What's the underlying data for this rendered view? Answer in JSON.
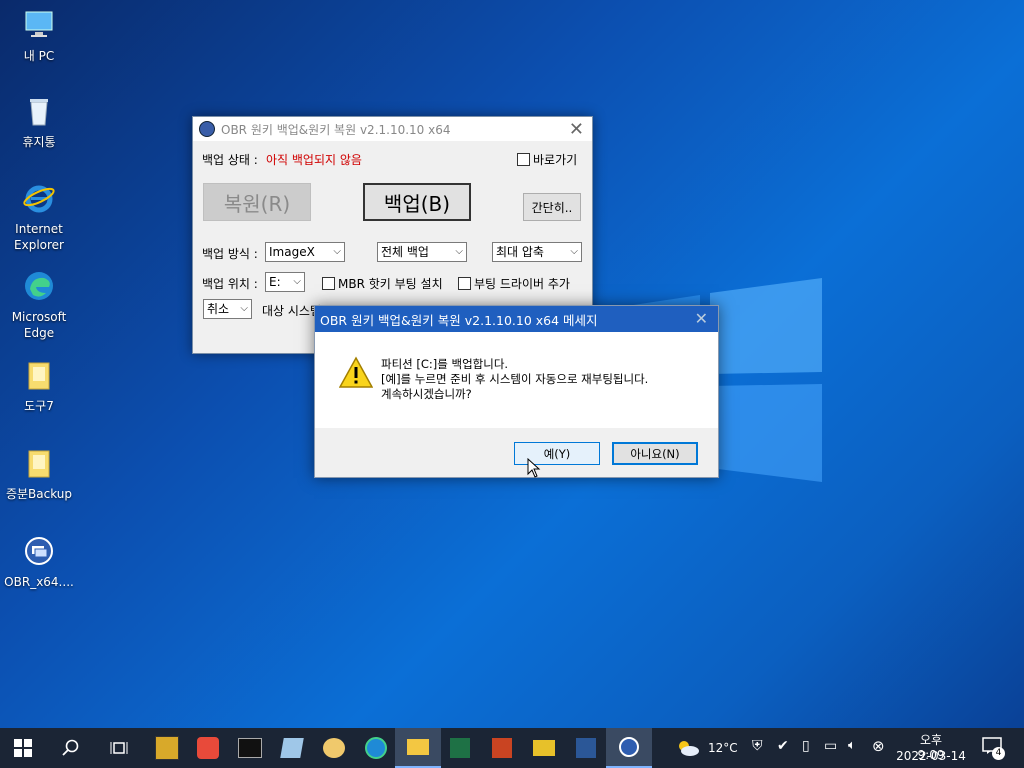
{
  "desktop": {
    "icons": [
      {
        "label": "내 PC",
        "icon": "computer-icon"
      },
      {
        "label": "휴지통",
        "icon": "recycle-bin-icon"
      },
      {
        "label": "Internet Explorer",
        "icon": "ie-icon"
      },
      {
        "label": "Microsoft Edge",
        "icon": "edge-icon"
      },
      {
        "label": "도구7",
        "icon": "folder-icon"
      },
      {
        "label": "증분Backup",
        "icon": "folder-icon"
      },
      {
        "label": "OBR_x64....",
        "icon": "obr-app-icon"
      }
    ]
  },
  "obr_window": {
    "title": "OBR 원키 백업&원키 복원 v2.1.10.10 x64",
    "status_label": "백업 상태 : ",
    "status_value": "아직 백업되지 않음",
    "shortcut_label": "바로가기",
    "restore_button": "복원(R)",
    "backup_button": "백업(B)",
    "simple_button": "간단히..",
    "method_label": "백업 방식 :",
    "method_value": "ImageX",
    "scope_value": "전체 백업",
    "compression_value": "최대 압축",
    "location_label": "백업 위치 :",
    "location_value": "E:",
    "mbr_label": "MBR 핫키 부팅 설치",
    "driver_label": "부팅 드라이버 추가",
    "cancel_combo": "취소",
    "target_text": "대상 시스템"
  },
  "message_box": {
    "title": "OBR 원키 백업&원키 복원 v2.1.10.10 x64 메세지",
    "line1": "파티션 [C:]를 백업합니다.",
    "line2": "[예]를 누르면 준비 후 시스템이 자동으로 재부팅됩니다.",
    "line3": "계속하시겠습니까?",
    "yes_button": "예(Y)",
    "no_button": "아니요(N)"
  },
  "taskbar": {
    "weather_temp": "12°C",
    "time": "오후 9:09",
    "date": "2022-03-14",
    "notification_count": "4"
  },
  "colors": {
    "accent": "#0078d7",
    "status_red": "#d00000",
    "msg_titlebar": "#1f5fbf",
    "taskbar": "#1b2535"
  }
}
